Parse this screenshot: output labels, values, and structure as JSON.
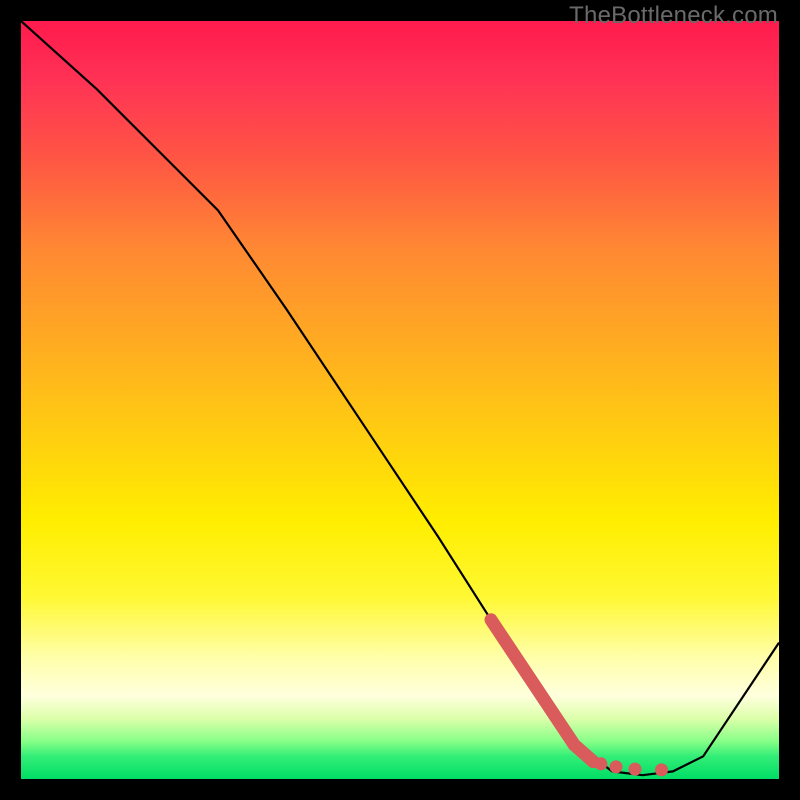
{
  "watermark": "TheBottleneck.com",
  "chart_data": {
    "type": "line",
    "title": "",
    "xlabel": "",
    "ylabel": "",
    "xlim": [
      0,
      100
    ],
    "ylim": [
      0,
      100
    ],
    "series": [
      {
        "name": "curve",
        "x": [
          0,
          10,
          20,
          26,
          35,
          45,
          55,
          62,
          68,
          74,
          78,
          82,
          86,
          90,
          100
        ],
        "y": [
          100,
          91,
          81,
          75,
          62,
          47,
          32,
          21,
          12,
          4,
          1,
          0.5,
          1,
          3,
          18
        ]
      }
    ],
    "highlight": {
      "name": "optimal-range",
      "segment_x": [
        62,
        68,
        73,
        75.5
      ],
      "segment_y": [
        21,
        12,
        4.5,
        2.3
      ],
      "dots": [
        {
          "x": 76.5,
          "y": 2.0
        },
        {
          "x": 78.5,
          "y": 1.6
        },
        {
          "x": 81.0,
          "y": 1.3
        },
        {
          "x": 84.5,
          "y": 1.2
        }
      ]
    },
    "colors": {
      "curve": "#000000",
      "highlight": "#d95b5b"
    }
  }
}
